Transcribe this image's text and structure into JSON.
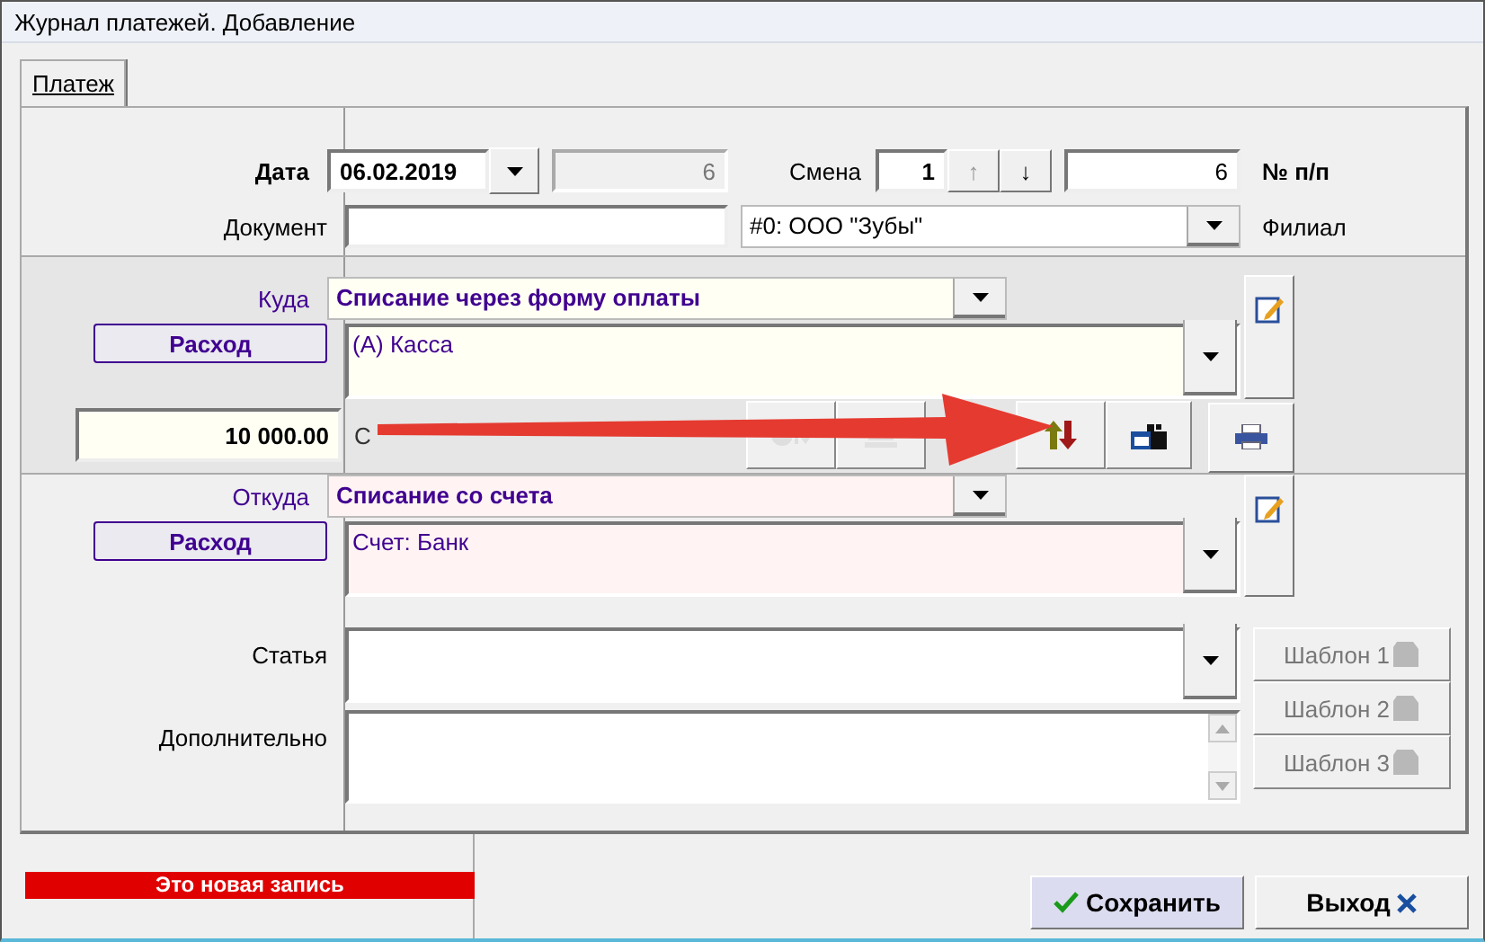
{
  "window": {
    "title": "Журнал платежей. Добавление"
  },
  "tabs": [
    {
      "label": "Платеж",
      "selected": true
    }
  ],
  "header": {
    "date_label": "Дата",
    "date": "06.02.2019",
    "number": "6",
    "shift_label": "Смена",
    "shift": "1",
    "shift_buttons": [
      {
        "label": "↑",
        "disabled": true
      },
      {
        "label": "↓",
        "disabled": false
      }
    ],
    "serial": "6",
    "serial_label": "№ п/п",
    "document_label": "Документ",
    "branch": "#0: ООО \"Зубы\"",
    "branch_label": "Филиал"
  },
  "destination": {
    "label": "Куда",
    "method": "Списание через форму оплаты",
    "type_button": "Расход",
    "account": "(А) Касса",
    "amount": "10 000.00",
    "amount_label": "С",
    "tools": [
      {
        "disabled": true
      },
      {
        "disabled": true
      },
      {
        "disabled": false
      },
      {
        "disabled": false
      }
    ]
  },
  "source": {
    "label": "Откуда",
    "method": "Списание со счета",
    "type_button": "Расход",
    "account": "Счет: Банк"
  },
  "details": {
    "article_label": "Статья",
    "extra_label": "Дополнительно"
  },
  "templates": [
    {
      "label": "Шаблон 1",
      "disabled": true
    },
    {
      "label": "Шаблон 2",
      "disabled": true
    },
    {
      "label": "Шаблон 3",
      "disabled": true
    }
  ],
  "status": "Это новая запись",
  "buttons": [
    {
      "label": "Сохранить",
      "kind": "save",
      "default": true
    },
    {
      "label": "Выход",
      "kind": "exit",
      "default": false
    }
  ]
}
